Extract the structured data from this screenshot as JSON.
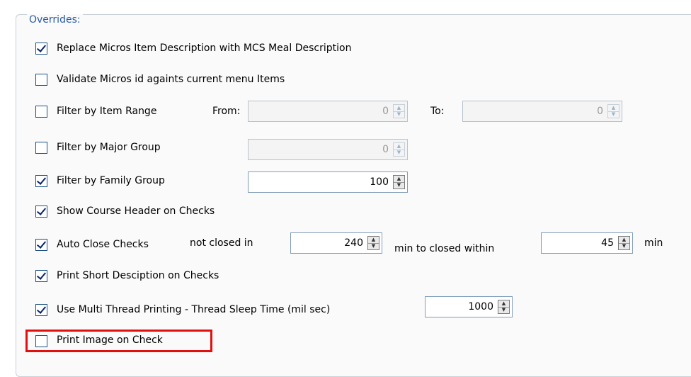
{
  "group_title": "Overrides:",
  "options": [
    {
      "id": "replace-desc",
      "label": "Replace Micros Item Description with  MCS Meal Description",
      "checked": true
    },
    {
      "id": "validate-id",
      "label": "Validate Micros id againts current menu Items",
      "checked": false
    },
    {
      "id": "filter-item-range",
      "label": "Filter by Item Range",
      "checked": false
    },
    {
      "id": "filter-major-group",
      "label": "Filter by Major Group",
      "checked": false
    },
    {
      "id": "filter-family-group",
      "label": "Filter by Family Group",
      "checked": true
    },
    {
      "id": "show-course-header",
      "label": "Show Course Header on Checks",
      "checked": true
    },
    {
      "id": "auto-close-checks",
      "label": "Auto Close Checks",
      "checked": true
    },
    {
      "id": "print-short-desc",
      "label": "Print Short Desciption on Checks",
      "checked": true
    },
    {
      "id": "multi-thread-print",
      "label": "Use Multi Thread Printing - Thread Sleep Time (mil sec)",
      "checked": true
    },
    {
      "id": "print-image",
      "label": "Print Image on Check",
      "checked": false
    }
  ],
  "item_range": {
    "from_label": "From:",
    "from_value": "0",
    "to_label": "To:",
    "to_value": "0"
  },
  "major_group": {
    "value": "0"
  },
  "family_group": {
    "value": "100"
  },
  "auto_close": {
    "not_closed_label": "not closed in",
    "not_closed_value": "240",
    "closed_within_label": "min to closed within",
    "closed_within_value": "45",
    "min_label": "min"
  },
  "thread_sleep": {
    "value": "1000"
  },
  "colors": {
    "legend": "#2a5aa8",
    "highlight": "#e01010",
    "checkmark": "#0a246a"
  }
}
